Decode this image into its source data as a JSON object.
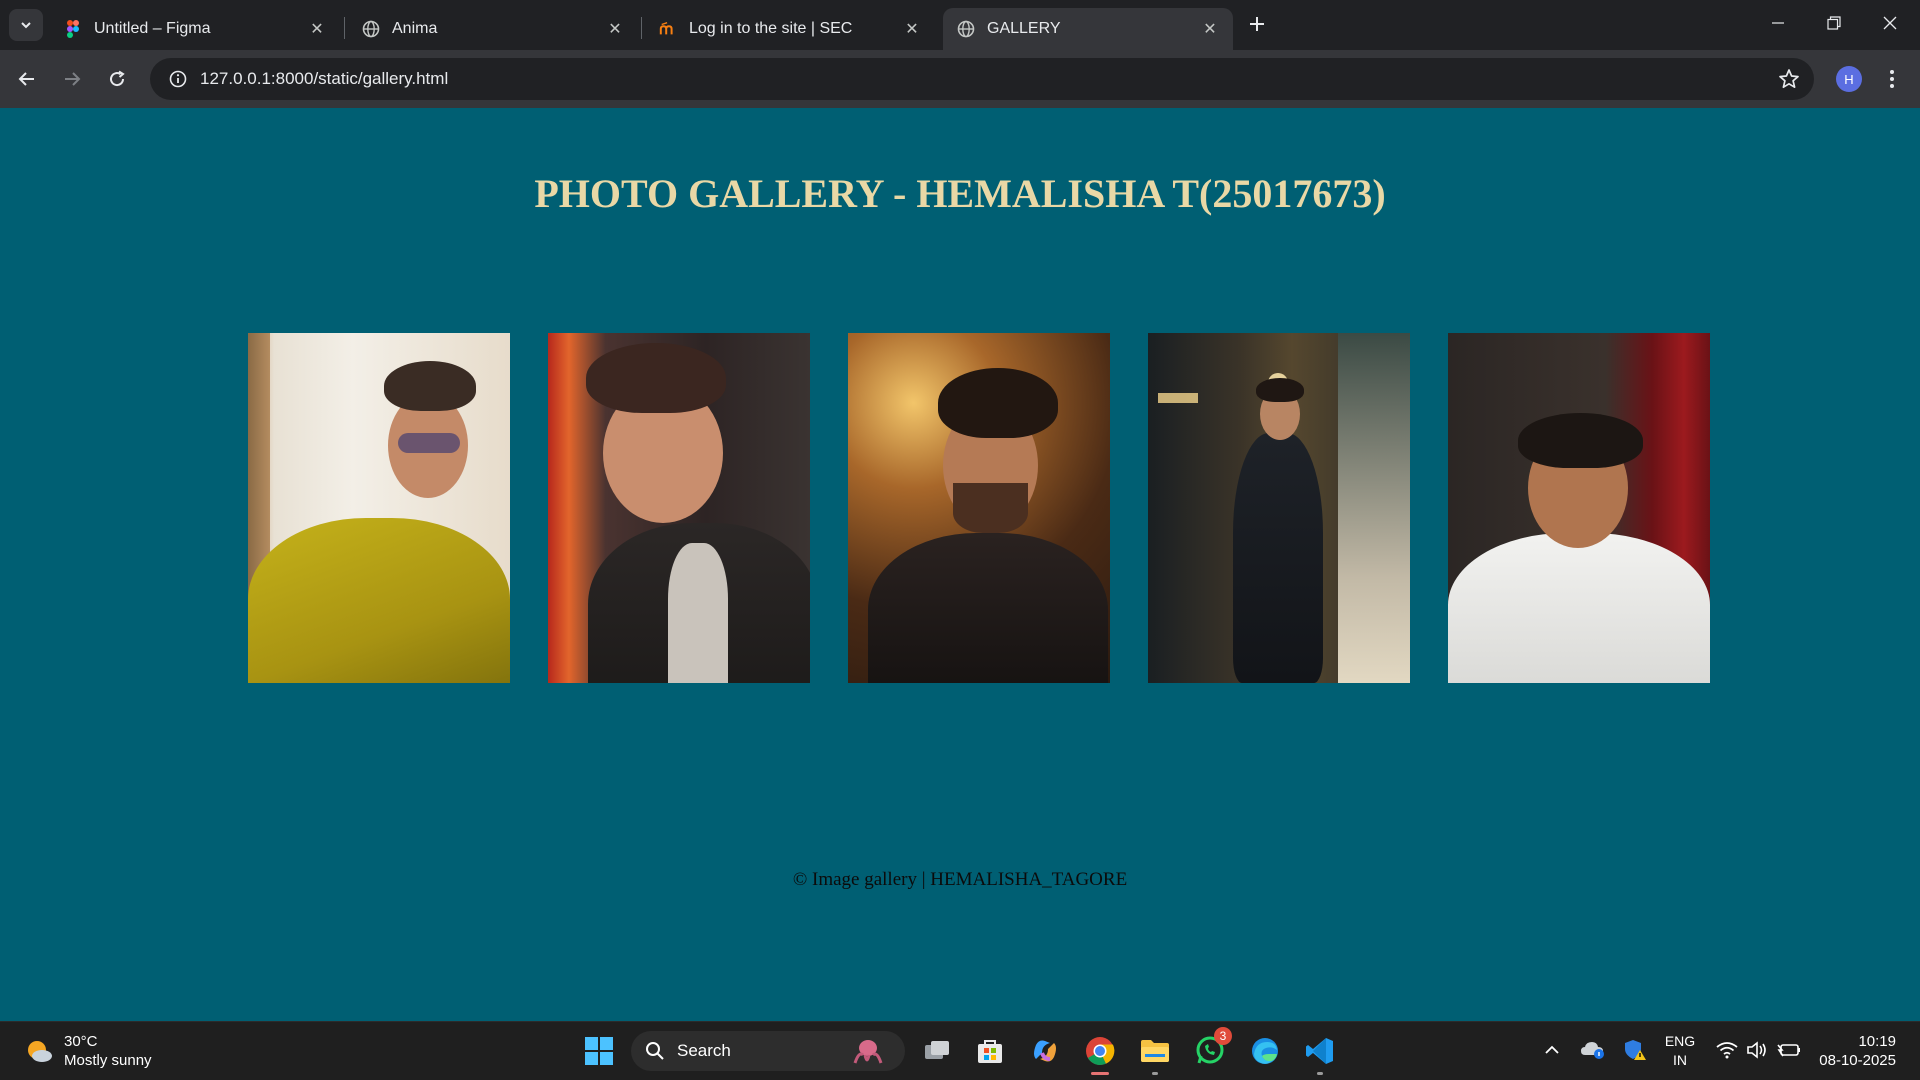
{
  "browser": {
    "tabs": [
      {
        "title": "Untitled – Figma",
        "icon": "figma-icon"
      },
      {
        "title": "Anima",
        "icon": "globe-icon"
      },
      {
        "title": "Log in to the site | SEC",
        "icon": "moodle-icon"
      },
      {
        "title": "GALLERY",
        "icon": "globe-icon",
        "active": true
      }
    ],
    "url": "127.0.0.1:8000/static/gallery.html",
    "profile_initial": "H"
  },
  "page": {
    "heading": "PHOTO GALLERY - HEMALISHA T(25017673)",
    "footer": "© Image gallery | HEMALISHA_TAGORE",
    "background": "#005f73",
    "heading_color": "#e9d8a6",
    "photos": [
      {
        "alt": "man in yellow kurta with sunglasses"
      },
      {
        "alt": "smiling man in dark shirt with necklace"
      },
      {
        "alt": "man with beard in black jacket"
      },
      {
        "alt": "man in black suit standing"
      },
      {
        "alt": "man in white shirt smiling"
      }
    ]
  },
  "taskbar": {
    "weather_temp": "30°C",
    "weather_desc": "Mostly sunny",
    "search_label": "Search",
    "whatsapp_badge": "3",
    "lang_top": "ENG",
    "lang_bottom": "IN",
    "time": "10:19",
    "date": "08-10-2025"
  }
}
